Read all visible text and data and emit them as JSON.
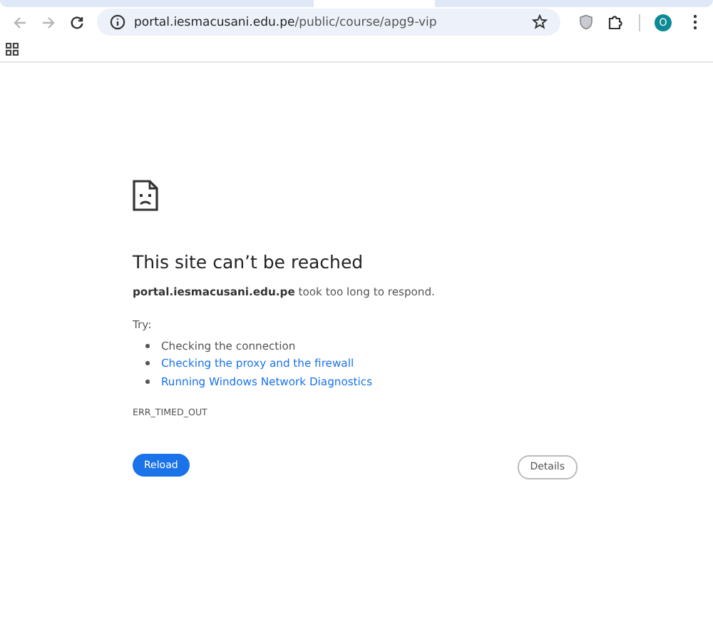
{
  "toolbar": {
    "url_host": "portal.iesmacusani.edu.pe",
    "url_path": "/public/course/apg9-vip",
    "avatar": "O",
    "back_disabled": true,
    "forward_disabled": true
  },
  "error": {
    "title": "This site can’t be reached",
    "message": "**portal.iesmacusani.edu.pe** took too long to respond.",
    "try_label": "Try:",
    "suggestions": [
      {
        "text": "Checking the connection",
        "kind": "text"
      },
      {
        "text": "Checking the proxy and the firewall",
        "kind": "link"
      },
      {
        "text": "Running Windows Network Diagnostics",
        "kind": "link"
      }
    ],
    "code": "ERR_TIMED_OUT"
  },
  "buttons": [
    {
      "label": "Reload",
      "kind": "primary"
    },
    {
      "label": "Details",
      "kind": "secondary"
    }
  ]
}
